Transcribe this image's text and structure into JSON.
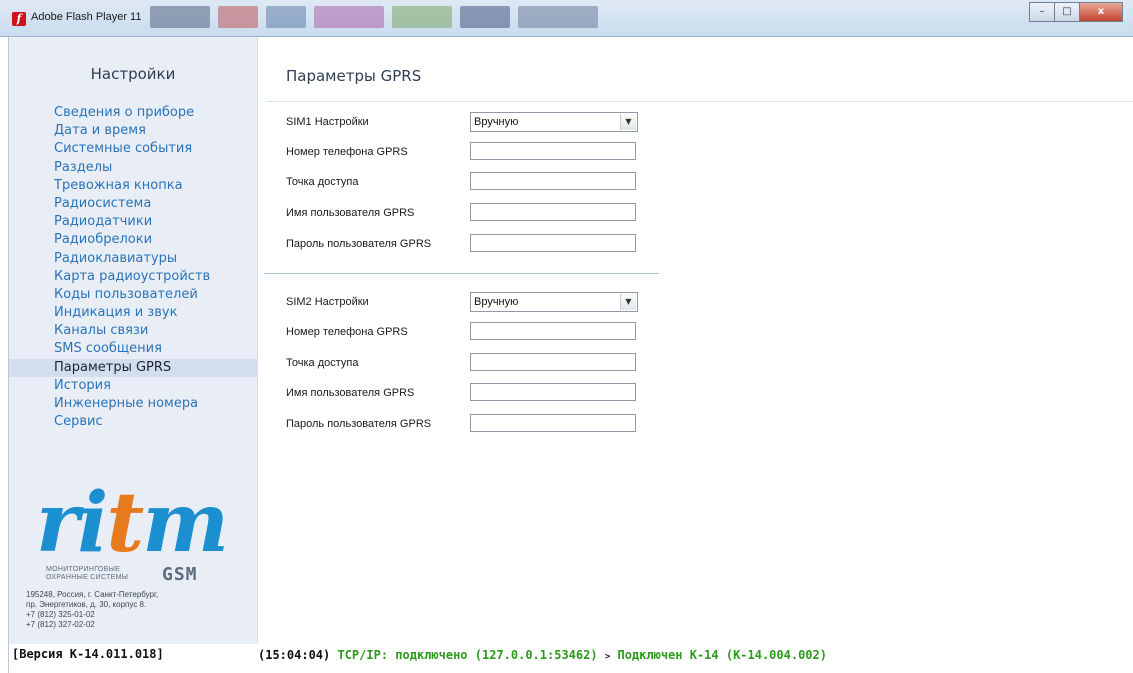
{
  "window": {
    "title": "Adobe Flash Player 11",
    "controls": [
      "–",
      "□",
      "x"
    ]
  },
  "sidebar": {
    "title": "Настройки",
    "items": [
      {
        "label": "Сведения о приборе"
      },
      {
        "label": "Дата и время"
      },
      {
        "label": "Системные события"
      },
      {
        "label": "Разделы"
      },
      {
        "label": "Тревожная кнопка"
      },
      {
        "label": "Радиосистема"
      },
      {
        "label": "Радиодатчики"
      },
      {
        "label": "Радиобрелоки"
      },
      {
        "label": "Радиоклавиатуры"
      },
      {
        "label": "Карта радиоустройств"
      },
      {
        "label": "Коды пользователей"
      },
      {
        "label": "Индикация и звук"
      },
      {
        "label": "Каналы связи"
      },
      {
        "label": "SMS сообщения"
      },
      {
        "label": "Параметры GPRS",
        "active": true
      },
      {
        "label": "История"
      },
      {
        "label": "Инженерные номера"
      },
      {
        "label": "Сервис"
      }
    ],
    "logo": {
      "word": "ritm",
      "subtitle_line1": "МОНИТОРИНГОВЫЕ",
      "subtitle_line2": "ОХРАННЫЕ СИСТЕМЫ",
      "gsm": "GSM",
      "accent_color": "#1b8fcf",
      "letter_color": "#e87a1e"
    },
    "address": [
      "195248, Россия, г. Санкт-Петербург,",
      "пр. Энергетиков, д. 30, корпус 8.",
      "+7 (812) 325-01-02",
      "+7 (812) 327-02-02"
    ],
    "version": "[Версия К-14.011.018]"
  },
  "main": {
    "title": "Параметры GPRS",
    "sim1": {
      "settings_label": "SIM1 Настройки",
      "settings_value": "Вручную",
      "phone_label": "Номер телефона GPRS",
      "phone_value": "",
      "apn_label": "Точка доступа",
      "apn_value": "",
      "user_label": "Имя пользователя GPRS",
      "user_value": "",
      "password_label": "Пароль пользователя GPRS",
      "password_value": ""
    },
    "sim2": {
      "settings_label": "SIM2 Настройки",
      "settings_value": "Вручную",
      "phone_label": "Номер телефона GPRS",
      "phone_value": "",
      "apn_label": "Точка доступа",
      "apn_value": "",
      "user_label": "Имя пользователя GPRS",
      "user_value": "",
      "password_label": "Пароль пользователя GPRS",
      "password_value": ""
    }
  },
  "status": {
    "time": "(15:04:04)",
    "connection": "TCP/IP: подключено (127.0.0.1:53462)",
    "arrow": ">",
    "device": "Подключен К-14 (К-14.004.002)",
    "ok_color": "#2c9a1b"
  }
}
